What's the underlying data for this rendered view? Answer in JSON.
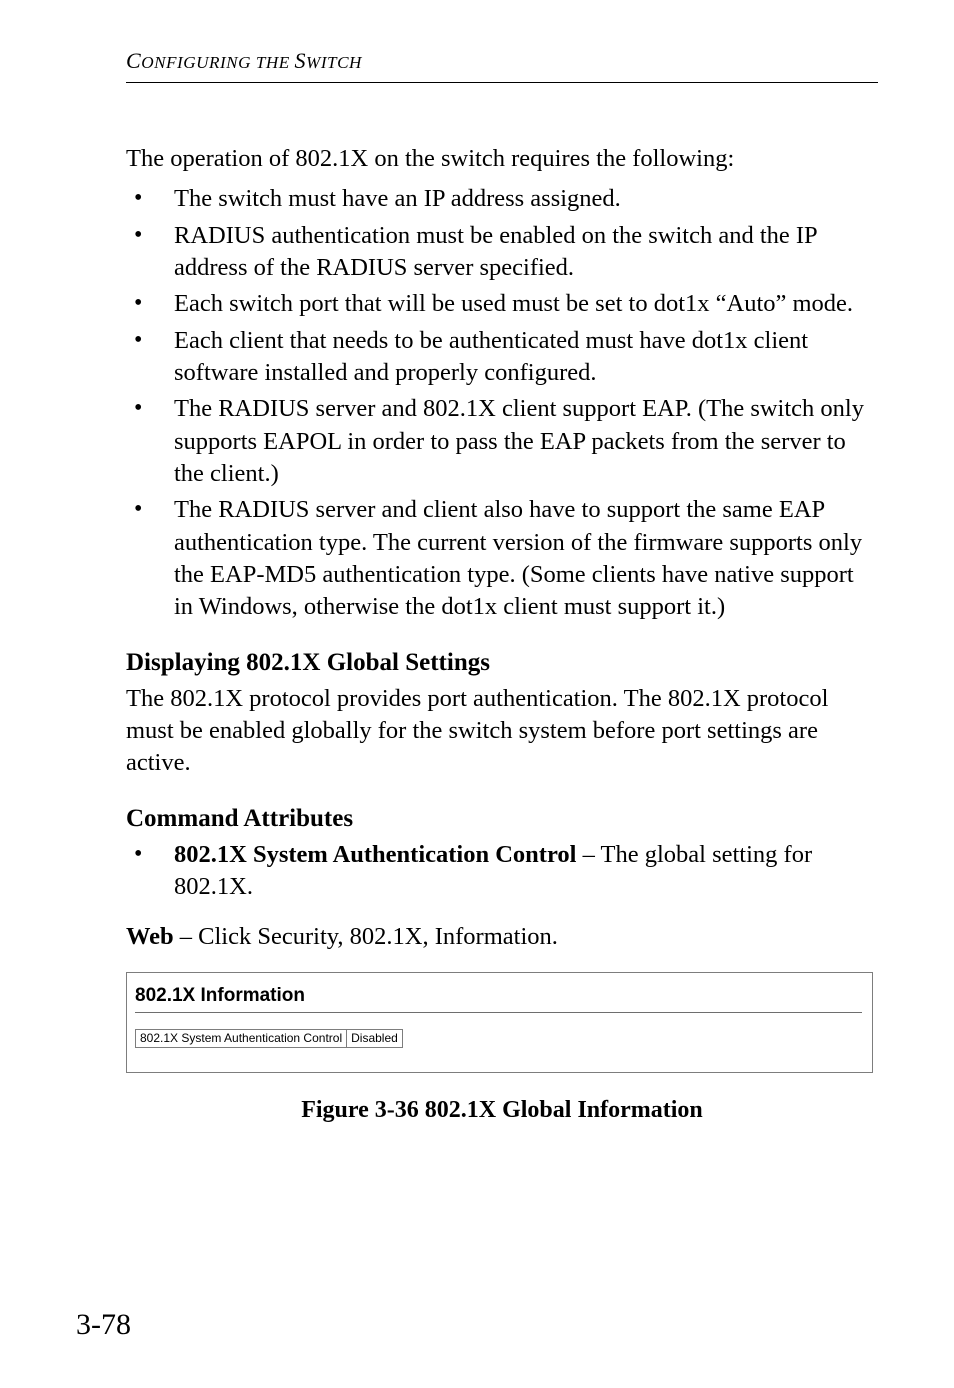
{
  "running_head": {
    "c": "C",
    "onfiguring": "ONFIGURING",
    "the": " THE ",
    "s": "S",
    "witch": "WITCH"
  },
  "intro": "The operation of 802.1X on the switch requires the following:",
  "bullets": [
    "The switch must have an IP address assigned.",
    "RADIUS authentication must be enabled on the switch and the IP address of the RADIUS server specified.",
    "Each switch port that will be used must be set to dot1x “Auto” mode.",
    "Each client that needs to be authenticated must have dot1x client software installed and properly configured.",
    "The RADIUS server and 802.1X client support EAP. (The switch only supports EAPOL in order to pass the EAP packets from the server to the client.)",
    "The RADIUS server and client also have to support the same EAP authentication type. The current version of the firmware supports only the EAP-MD5 authentication type. (Some clients have native support in Windows, otherwise the dot1x client must support it.)"
  ],
  "section_heading": "Displaying 802.1X Global Settings",
  "section_para": "The 802.1X protocol provides port authentication. The 802.1X protocol must be enabled globally for the switch system before port settings are active.",
  "cmd_attr_heading": "Command Attributes",
  "cmd_attr_bold": "802.1X System Authentication Control",
  "cmd_attr_rest": " – The global setting for 802.1X.",
  "web_bold": "Web",
  "web_rest": " – Click Security, 802.1X, Information.",
  "panel": {
    "title": "802.1X Information",
    "row_label": "802.1X System Authentication Control",
    "row_value": "Disabled"
  },
  "figure_caption": "Figure 3-36  802.1X Global Information",
  "page_number": "3-78"
}
